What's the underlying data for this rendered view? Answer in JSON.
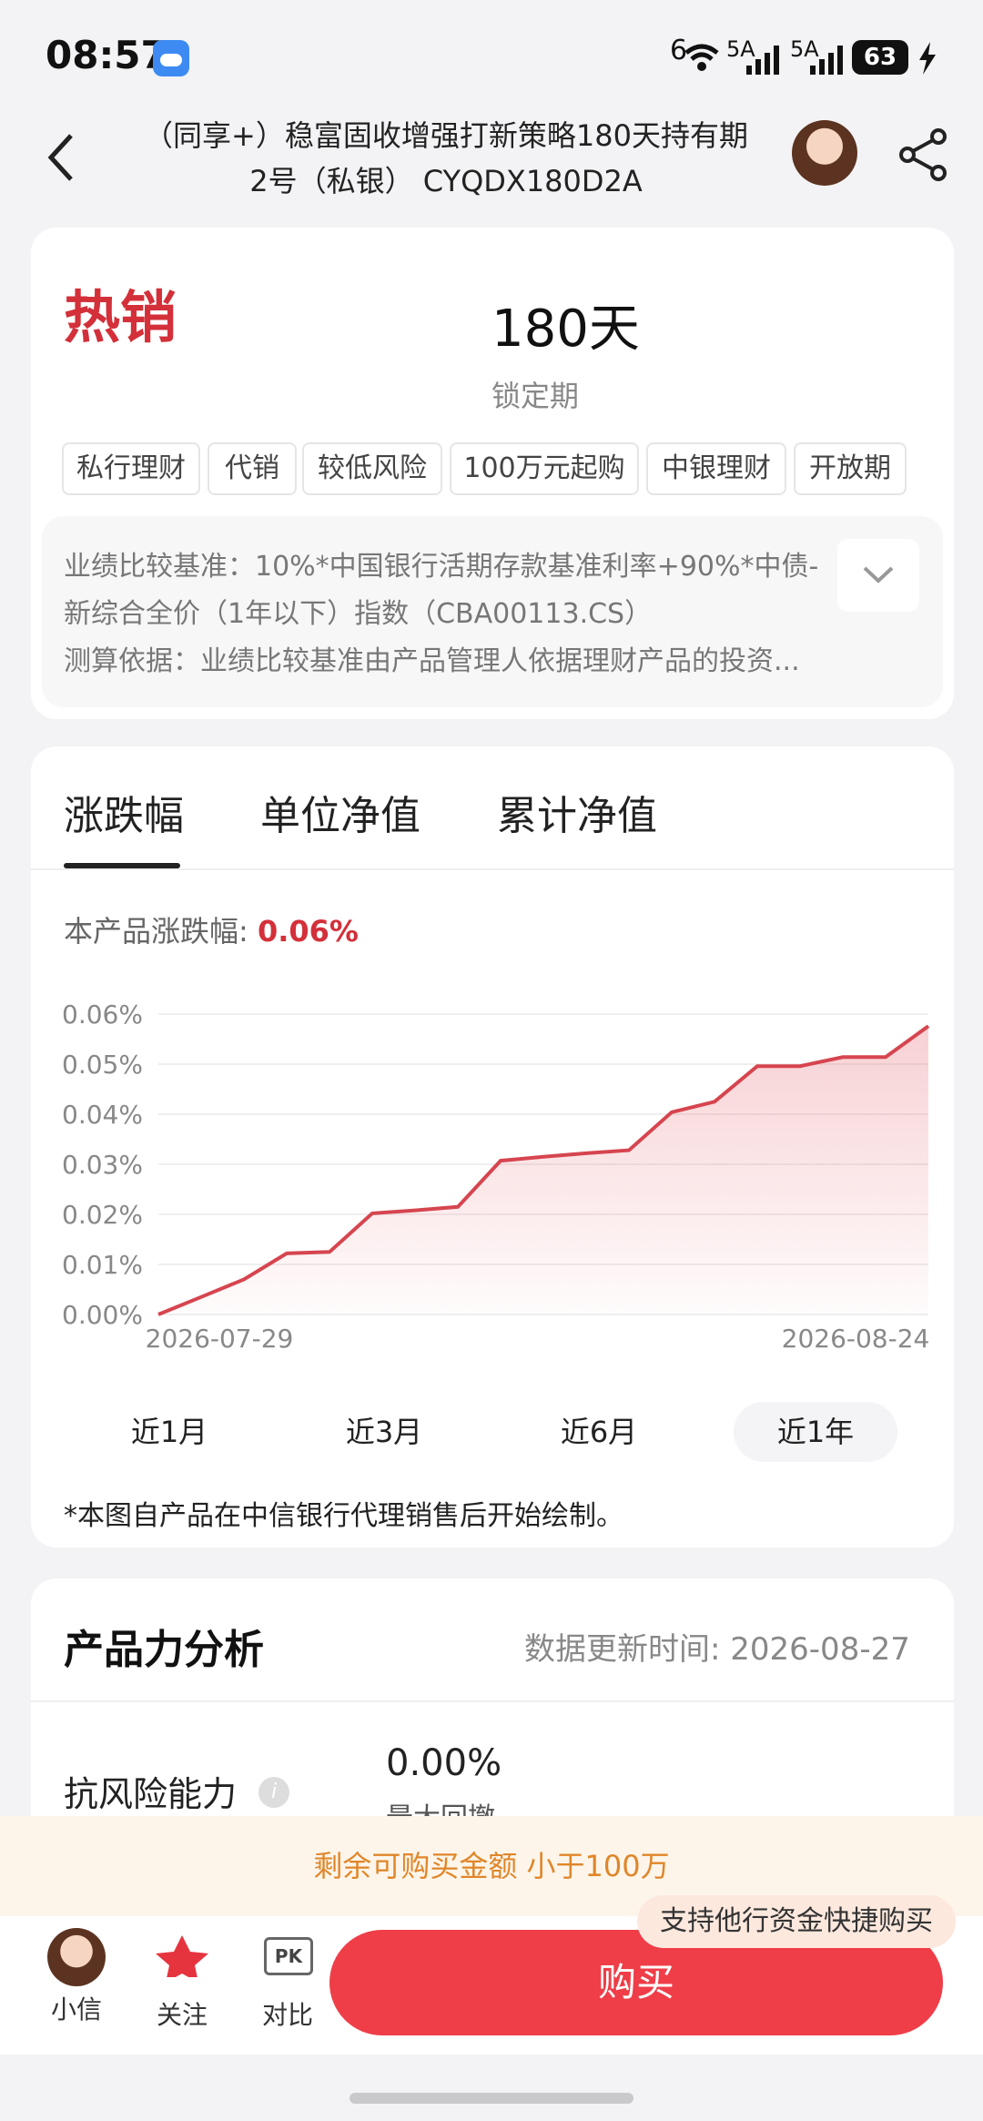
{
  "status": {
    "time": "08:57",
    "signal1": "6",
    "signal2": "5A",
    "signal3": "5A",
    "battery": "63"
  },
  "nav": {
    "title": "（同享+）稳富固收增强打新策略180天持有期2号（私银）  CYQDX180D2A"
  },
  "summary": {
    "hot_label": "热销",
    "lock_value": "180天",
    "lock_label": "锁定期",
    "tags": [
      "私行理财",
      "代销",
      "较低风险",
      "100万元起购",
      "中银理财",
      "开放期"
    ],
    "benchmark_line1": "业绩比较基准：10%*中国银行活期存款基准利率+90%*中债-",
    "benchmark_line2": "新综合全价（1年以下）指数（CBA00113.CS）",
    "basis_line": "测算依据：业绩比较基准由产品管理人依据理财产品的投资..."
  },
  "chart_section": {
    "tabs": [
      "涨跌幅",
      "单位净值",
      "累计净值"
    ],
    "active_tab": 0,
    "change_label": "本产品涨跌幅: ",
    "change_value": "0.06%",
    "ranges": [
      "近1月",
      "近3月",
      "近6月",
      "近1年"
    ],
    "selected_range": 3,
    "footnote": "*本图自产品在中信银行代理销售后开始绘制。"
  },
  "chart_data": {
    "type": "area",
    "x_start": "2026-07-29",
    "x_end": "2026-08-24",
    "yticks": [
      "0.00%",
      "0.01%",
      "0.02%",
      "0.03%",
      "0.04%",
      "0.05%",
      "0.06%"
    ],
    "ylim": [
      0,
      0.06
    ],
    "values": [
      0.0,
      0.0035,
      0.007,
      0.0122,
      0.0125,
      0.0202,
      0.0208,
      0.0215,
      0.0307,
      0.0315,
      0.0322,
      0.0328,
      0.0404,
      0.0425,
      0.0496,
      0.0496,
      0.0514,
      0.0514,
      0.0576
    ],
    "line_color": "#d6454f"
  },
  "analysis": {
    "title": "产品力分析",
    "update_label": "数据更新时间:  2026-08-27",
    "risk_label": "抗风险能力",
    "drawdown_value": "0.00%",
    "drawdown_label": "最大回撤"
  },
  "bottom": {
    "remaining": "剩余可购买金额  小于100万",
    "assistant": "小信",
    "follow": "关注",
    "pk": "PK",
    "compare": "对比",
    "buy": "购买",
    "bubble": "支持他行资金快捷购买"
  }
}
